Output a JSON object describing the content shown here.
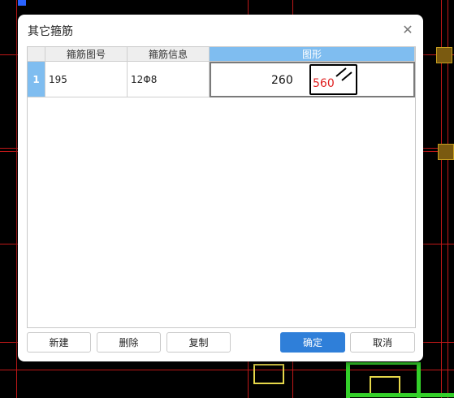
{
  "dialog": {
    "title": "其它箍筋",
    "close_label": "✕"
  },
  "table": {
    "columns": [
      "箍筋图号",
      "箍筋信息",
      "图形"
    ],
    "rows": [
      {
        "row_number": "1",
        "figure_no": "195",
        "rebar_info": "12Φ8",
        "shape": {
          "width": "260",
          "height": "560"
        }
      }
    ]
  },
  "buttons": {
    "new": "新建",
    "delete": "删除",
    "copy": "复制",
    "ok": "确定",
    "cancel": "取消"
  },
  "colors": {
    "accent": "#2f7fd9",
    "header_selected": "#7fbdf0",
    "shape_height_text": "#e02020"
  }
}
